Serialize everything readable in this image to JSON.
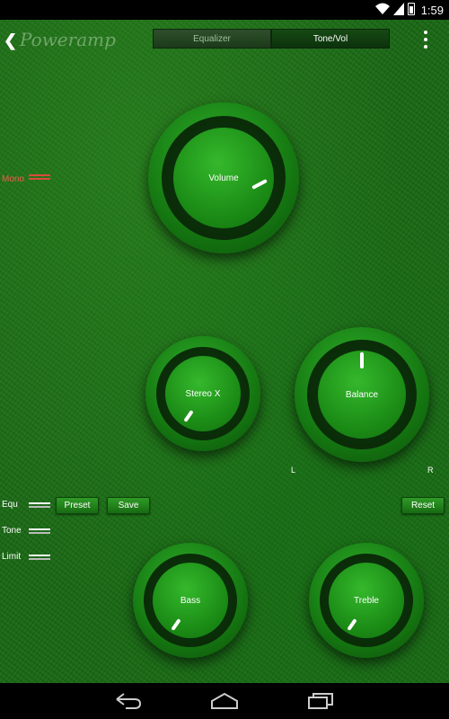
{
  "status_bar": {
    "time": "1:59"
  },
  "top_bar": {
    "logo": "Poweramp",
    "tabs": [
      {
        "label": "Equalizer",
        "active": false
      },
      {
        "label": "Tone/Vol",
        "active": true
      }
    ]
  },
  "side": {
    "mono_label": "Mono",
    "equ_label": "Equ",
    "tone_label": "Tone",
    "limit_label": "Limit"
  },
  "buttons": {
    "preset": "Preset",
    "save": "Save",
    "reset": "Reset"
  },
  "knobs": {
    "volume": "Volume",
    "stereo_x": "Stereo X",
    "balance": "Balance",
    "bass": "Bass",
    "treble": "Treble"
  },
  "balance_scale": {
    "left": "L",
    "right": "R"
  },
  "colors": {
    "accent": "#1a8a15",
    "mono_active": "#f25b4d"
  },
  "icons": [
    "wifi-icon",
    "signal-icon",
    "battery-icon",
    "back-icon",
    "overflow-menu-icon",
    "nav-back-icon",
    "nav-home-icon",
    "nav-recents-icon"
  ]
}
